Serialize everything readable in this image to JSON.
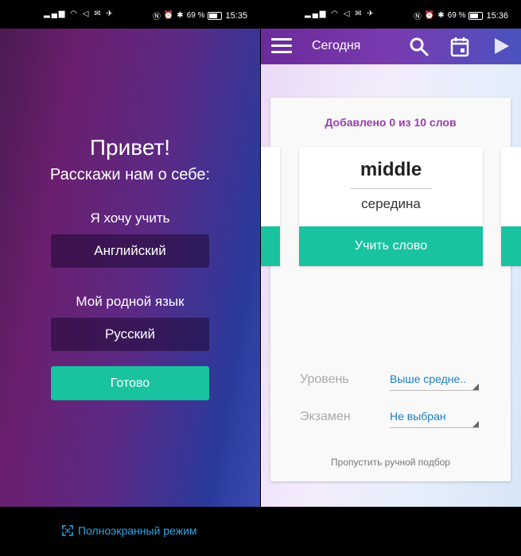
{
  "left_screen": {
    "status": {
      "time": "15:35",
      "battery": "69 %"
    },
    "title": "Привет!",
    "subtitle": "Расскажи нам о себе:",
    "learn_label": "Я хочу учить",
    "learn_value": "Английский",
    "native_label": "Мой родной язык",
    "native_value": "Русский",
    "done_button": "Готово"
  },
  "right_screen": {
    "status": {
      "time": "15:36",
      "battery": "69 %"
    },
    "appbar": {
      "title": "Сегодня",
      "icons": [
        "menu-icon",
        "search-icon",
        "calendar-icon",
        "play-icon"
      ]
    },
    "added_text": "Добавлено 0 из 10 слов",
    "word": "middle",
    "translation": "середина",
    "learn_button": "Учить слово",
    "level_label": "Уровень",
    "level_value": "Выше средне..",
    "exam_label": "Экзамен",
    "exam_value": "Не выбран",
    "skip_text": "Пропустить ручной подбор"
  },
  "bottom": {
    "fullscreen_label": "Полноэкранный режим"
  },
  "colors": {
    "accent_green": "#19c3a0",
    "purple_text": "#9b3db0",
    "link_blue": "#2aa6e8"
  }
}
